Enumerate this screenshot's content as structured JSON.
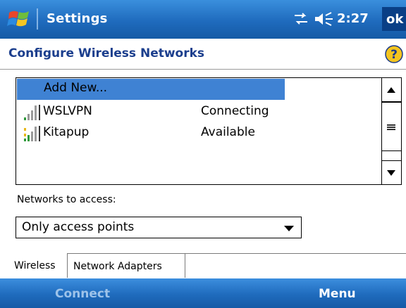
{
  "titlebar": {
    "app_title": "Settings",
    "time": "2:27",
    "ok_label": "ok",
    "icons": [
      "windows-start-icon",
      "network-connectivity-icon",
      "volume-icon"
    ],
    "color": "#1f6bbd"
  },
  "page": {
    "title": "Configure Wireless Networks",
    "help_icon": "help-icon"
  },
  "networks": {
    "add_new_label": "Add New...",
    "items": [
      {
        "name": "WSLVPN",
        "status": "Connecting",
        "icon": "signal-strength-icon"
      },
      {
        "name": "Kitapup",
        "status": "Available",
        "icon": "signal-strength-icon"
      }
    ],
    "selection_color": "#3f82d3"
  },
  "access": {
    "label": "Networks to access:",
    "selected": "Only access points"
  },
  "tabs": [
    {
      "label": "Wireless",
      "active": true
    },
    {
      "label": "Network Adapters",
      "active": false
    }
  ],
  "softkeys": {
    "left": "Connect",
    "right": "Menu"
  }
}
